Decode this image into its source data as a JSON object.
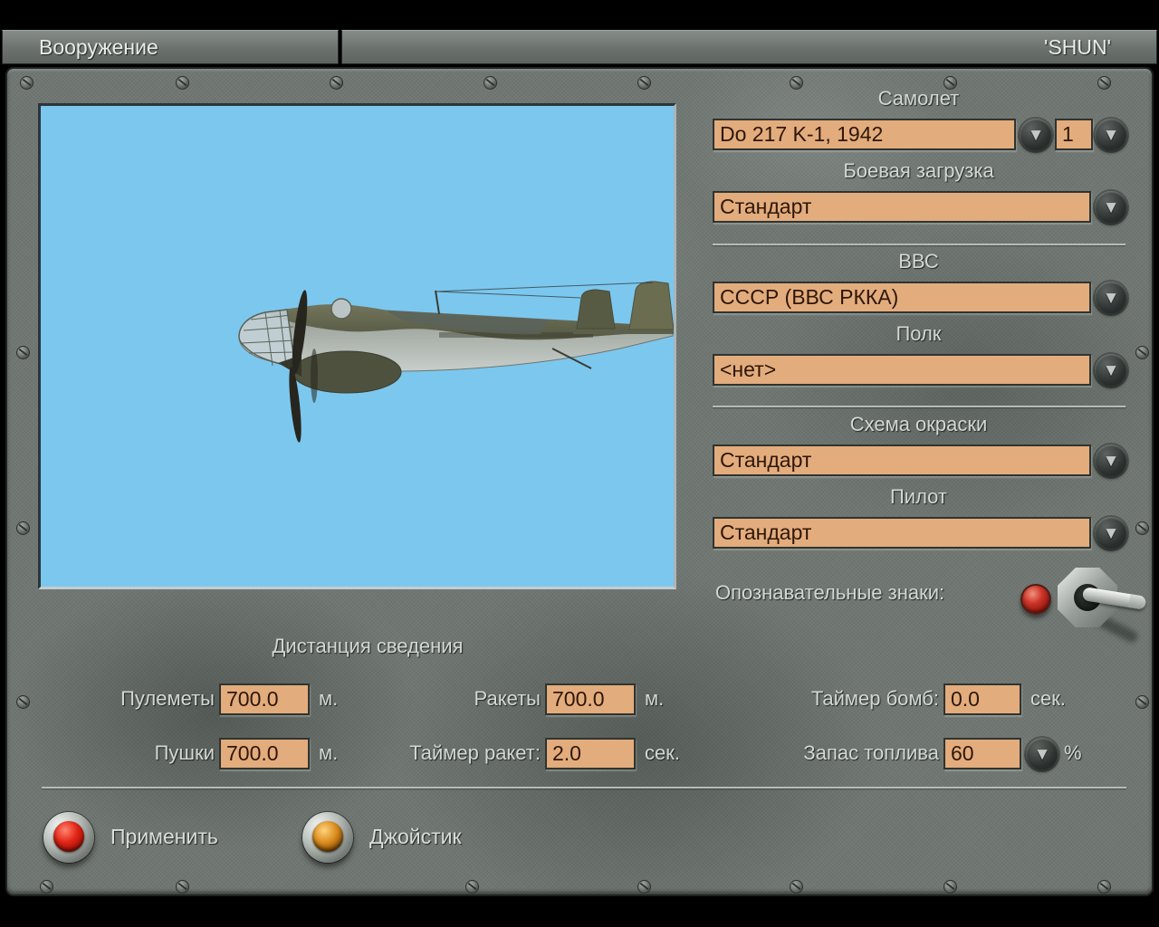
{
  "titlebar": {
    "screen_title": "Вооружение",
    "player_name": "'SHUN'"
  },
  "right_panel": {
    "aircraft": {
      "label": "Самолет",
      "value": "Do 217 K-1, 1942",
      "count": "1"
    },
    "loadout": {
      "label": "Боевая загрузка",
      "value": "Стандарт"
    },
    "airforce": {
      "label": "ВВС",
      "value": "СССР (ВВС РККА)"
    },
    "regiment": {
      "label": "Полк",
      "value": "<нет>"
    },
    "paint_scheme": {
      "label": "Схема окраски",
      "value": "Стандарт"
    },
    "pilot": {
      "label": "Пилот",
      "value": "Стандарт"
    },
    "markings_label": "Опознавательные знаки:"
  },
  "convergence": {
    "title": "Дистанция сведения",
    "machine_guns": {
      "label": "Пулеметы",
      "value": "700.0",
      "unit": "м."
    },
    "cannons": {
      "label": "Пушки",
      "value": "700.0",
      "unit": "м."
    },
    "rockets": {
      "label": "Ракеты",
      "value": "700.0",
      "unit": "м."
    },
    "rocket_timer": {
      "label": "Таймер ракет:",
      "value": "2.0",
      "unit": "сек."
    },
    "bomb_timer": {
      "label": "Таймер бомб:",
      "value": "0.0",
      "unit": "сек."
    },
    "fuel": {
      "label": "Запас топлива",
      "value": "60",
      "unit": "%"
    }
  },
  "actions": {
    "apply_label": "Применить",
    "joystick_label": "Джойстик"
  },
  "icons": {
    "dropdown_arrow": "▼"
  },
  "colors": {
    "field_bg": "#e3ac7d",
    "field_text": "#2d1708",
    "panel_metal": "#747b76",
    "preview_sky": "#7cc7ee",
    "lamp_red": "#c6241a",
    "apply_button_red": "#d2190b",
    "joystick_button_amber": "#c87f16"
  }
}
